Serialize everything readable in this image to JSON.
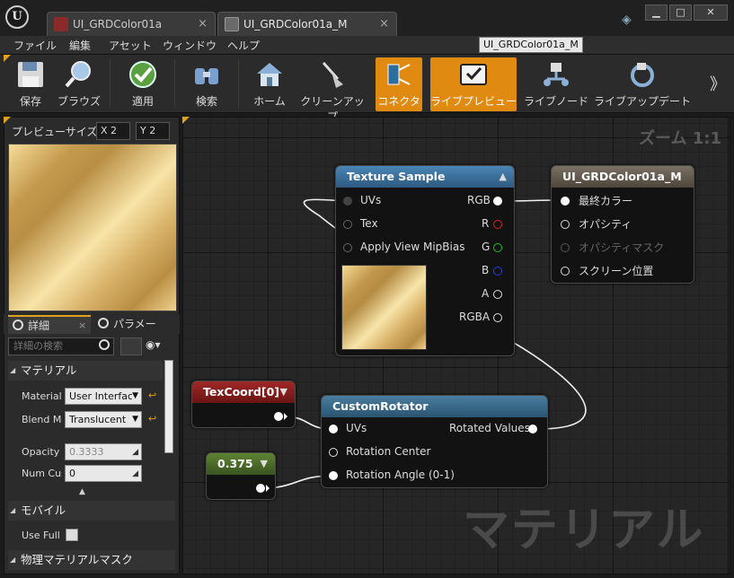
{
  "titlebar": {
    "tabs": [
      {
        "label": "UI_GRDColor01a",
        "close": "×"
      },
      {
        "label": "UI_GRDColor01a_M",
        "close": "×"
      }
    ],
    "window_buttons": {
      "minimize": "▁",
      "maximize": "□",
      "close": "✕"
    }
  },
  "menu": {
    "items": [
      "ファイル",
      "編集",
      "アセット",
      "ウィンドウ",
      "ヘルプ"
    ],
    "tooltip": "UI_GRDColor01a_M"
  },
  "toolbar": {
    "buttons": [
      {
        "label": "保存",
        "icon": "save-icon",
        "active": false
      },
      {
        "label": "ブラウズ",
        "icon": "browse-icon",
        "active": false
      },
      {
        "label": "適用",
        "icon": "apply-icon",
        "active": false
      },
      {
        "label": "検索",
        "icon": "search-binoculars-icon",
        "active": false
      },
      {
        "label": "ホーム",
        "icon": "home-icon",
        "active": false
      },
      {
        "label": "クリーンアップ",
        "icon": "cleanup-icon",
        "active": false
      },
      {
        "label": "コネクタ",
        "icon": "connector-icon",
        "active": true
      },
      {
        "label": "ライブプレビュー",
        "icon": "live-preview-icon",
        "active": true
      },
      {
        "label": "ライブノード",
        "icon": "live-node-icon",
        "active": false
      },
      {
        "label": "ライブアップデート",
        "icon": "live-update-icon",
        "active": false
      }
    ],
    "more": "》"
  },
  "preview_panel": {
    "size_label": "プレビューサイズ",
    "x_label": "X",
    "x_value": "2",
    "y_label": "Y",
    "y_value": "2"
  },
  "details": {
    "tabs": [
      {
        "label": "詳細",
        "close": "×"
      },
      {
        "label": "パラメー"
      }
    ],
    "search_placeholder": "詳細の検索",
    "sections": {
      "material": "マテリアル",
      "mobile": "モバイル",
      "physical_mask": "物理マテリアルマスク"
    },
    "properties": [
      {
        "label": "Material",
        "value": "User Interfac"
      },
      {
        "label": "Blend Mo",
        "value": "Translucent"
      },
      {
        "label": "Opacity I",
        "value": "0.3333"
      },
      {
        "label": "Num Cus",
        "value": "0"
      },
      {
        "label": "Use Full",
        "value": ""
      }
    ]
  },
  "graph": {
    "zoom": "ズーム 1:1",
    "watermark": "マテリアル",
    "nodes": {
      "texture_sample": {
        "title": "Texture Sample",
        "inputs": [
          "UVs",
          "Tex",
          "Apply View MipBias"
        ],
        "outputs": [
          "RGB",
          "R",
          "G",
          "B",
          "A",
          "RGBA"
        ]
      },
      "material_result": {
        "title": "UI_GRDColor01a_M",
        "inputs": [
          "最終カラー",
          "オパシティ",
          "オパシティマスク",
          "スクリーン位置"
        ]
      },
      "texcoord": {
        "title": "TexCoord[0]"
      },
      "custom_rotator": {
        "title": "CustomRotator",
        "inputs": [
          "UVs",
          "Rotation Center",
          "Rotation Angle (0-1)"
        ],
        "output": "Rotated Values"
      },
      "constant": {
        "title": "0.375"
      }
    }
  },
  "colors": {
    "accent": "#e0a21c",
    "active_button": "#e08a12",
    "texture_header": "#3b6c94",
    "result_header": "#6e6458",
    "texcoord_header": "#8a1e1e",
    "rotator_header": "#3a6580",
    "constant_header": "#4e6e2a",
    "pin_r": "#e02020",
    "pin_g": "#20c020",
    "pin_b": "#2040e0"
  }
}
